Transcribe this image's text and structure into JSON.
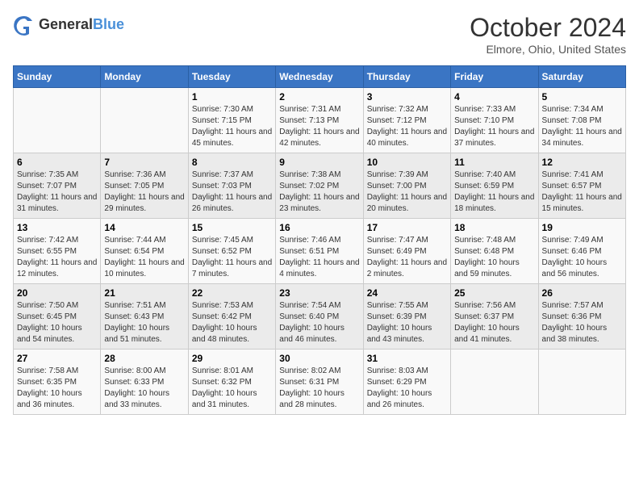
{
  "header": {
    "logo_general": "General",
    "logo_blue": "Blue",
    "month_title": "October 2024",
    "location": "Elmore, Ohio, United States"
  },
  "days_of_week": [
    "Sunday",
    "Monday",
    "Tuesday",
    "Wednesday",
    "Thursday",
    "Friday",
    "Saturday"
  ],
  "weeks": [
    [
      {
        "day": "",
        "sunrise": "",
        "sunset": "",
        "daylight": ""
      },
      {
        "day": "",
        "sunrise": "",
        "sunset": "",
        "daylight": ""
      },
      {
        "day": "1",
        "sunrise": "Sunrise: 7:30 AM",
        "sunset": "Sunset: 7:15 PM",
        "daylight": "Daylight: 11 hours and 45 minutes."
      },
      {
        "day": "2",
        "sunrise": "Sunrise: 7:31 AM",
        "sunset": "Sunset: 7:13 PM",
        "daylight": "Daylight: 11 hours and 42 minutes."
      },
      {
        "day": "3",
        "sunrise": "Sunrise: 7:32 AM",
        "sunset": "Sunset: 7:12 PM",
        "daylight": "Daylight: 11 hours and 40 minutes."
      },
      {
        "day": "4",
        "sunrise": "Sunrise: 7:33 AM",
        "sunset": "Sunset: 7:10 PM",
        "daylight": "Daylight: 11 hours and 37 minutes."
      },
      {
        "day": "5",
        "sunrise": "Sunrise: 7:34 AM",
        "sunset": "Sunset: 7:08 PM",
        "daylight": "Daylight: 11 hours and 34 minutes."
      }
    ],
    [
      {
        "day": "6",
        "sunrise": "Sunrise: 7:35 AM",
        "sunset": "Sunset: 7:07 PM",
        "daylight": "Daylight: 11 hours and 31 minutes."
      },
      {
        "day": "7",
        "sunrise": "Sunrise: 7:36 AM",
        "sunset": "Sunset: 7:05 PM",
        "daylight": "Daylight: 11 hours and 29 minutes."
      },
      {
        "day": "8",
        "sunrise": "Sunrise: 7:37 AM",
        "sunset": "Sunset: 7:03 PM",
        "daylight": "Daylight: 11 hours and 26 minutes."
      },
      {
        "day": "9",
        "sunrise": "Sunrise: 7:38 AM",
        "sunset": "Sunset: 7:02 PM",
        "daylight": "Daylight: 11 hours and 23 minutes."
      },
      {
        "day": "10",
        "sunrise": "Sunrise: 7:39 AM",
        "sunset": "Sunset: 7:00 PM",
        "daylight": "Daylight: 11 hours and 20 minutes."
      },
      {
        "day": "11",
        "sunrise": "Sunrise: 7:40 AM",
        "sunset": "Sunset: 6:59 PM",
        "daylight": "Daylight: 11 hours and 18 minutes."
      },
      {
        "day": "12",
        "sunrise": "Sunrise: 7:41 AM",
        "sunset": "Sunset: 6:57 PM",
        "daylight": "Daylight: 11 hours and 15 minutes."
      }
    ],
    [
      {
        "day": "13",
        "sunrise": "Sunrise: 7:42 AM",
        "sunset": "Sunset: 6:55 PM",
        "daylight": "Daylight: 11 hours and 12 minutes."
      },
      {
        "day": "14",
        "sunrise": "Sunrise: 7:44 AM",
        "sunset": "Sunset: 6:54 PM",
        "daylight": "Daylight: 11 hours and 10 minutes."
      },
      {
        "day": "15",
        "sunrise": "Sunrise: 7:45 AM",
        "sunset": "Sunset: 6:52 PM",
        "daylight": "Daylight: 11 hours and 7 minutes."
      },
      {
        "day": "16",
        "sunrise": "Sunrise: 7:46 AM",
        "sunset": "Sunset: 6:51 PM",
        "daylight": "Daylight: 11 hours and 4 minutes."
      },
      {
        "day": "17",
        "sunrise": "Sunrise: 7:47 AM",
        "sunset": "Sunset: 6:49 PM",
        "daylight": "Daylight: 11 hours and 2 minutes."
      },
      {
        "day": "18",
        "sunrise": "Sunrise: 7:48 AM",
        "sunset": "Sunset: 6:48 PM",
        "daylight": "Daylight: 10 hours and 59 minutes."
      },
      {
        "day": "19",
        "sunrise": "Sunrise: 7:49 AM",
        "sunset": "Sunset: 6:46 PM",
        "daylight": "Daylight: 10 hours and 56 minutes."
      }
    ],
    [
      {
        "day": "20",
        "sunrise": "Sunrise: 7:50 AM",
        "sunset": "Sunset: 6:45 PM",
        "daylight": "Daylight: 10 hours and 54 minutes."
      },
      {
        "day": "21",
        "sunrise": "Sunrise: 7:51 AM",
        "sunset": "Sunset: 6:43 PM",
        "daylight": "Daylight: 10 hours and 51 minutes."
      },
      {
        "day": "22",
        "sunrise": "Sunrise: 7:53 AM",
        "sunset": "Sunset: 6:42 PM",
        "daylight": "Daylight: 10 hours and 48 minutes."
      },
      {
        "day": "23",
        "sunrise": "Sunrise: 7:54 AM",
        "sunset": "Sunset: 6:40 PM",
        "daylight": "Daylight: 10 hours and 46 minutes."
      },
      {
        "day": "24",
        "sunrise": "Sunrise: 7:55 AM",
        "sunset": "Sunset: 6:39 PM",
        "daylight": "Daylight: 10 hours and 43 minutes."
      },
      {
        "day": "25",
        "sunrise": "Sunrise: 7:56 AM",
        "sunset": "Sunset: 6:37 PM",
        "daylight": "Daylight: 10 hours and 41 minutes."
      },
      {
        "day": "26",
        "sunrise": "Sunrise: 7:57 AM",
        "sunset": "Sunset: 6:36 PM",
        "daylight": "Daylight: 10 hours and 38 minutes."
      }
    ],
    [
      {
        "day": "27",
        "sunrise": "Sunrise: 7:58 AM",
        "sunset": "Sunset: 6:35 PM",
        "daylight": "Daylight: 10 hours and 36 minutes."
      },
      {
        "day": "28",
        "sunrise": "Sunrise: 8:00 AM",
        "sunset": "Sunset: 6:33 PM",
        "daylight": "Daylight: 10 hours and 33 minutes."
      },
      {
        "day": "29",
        "sunrise": "Sunrise: 8:01 AM",
        "sunset": "Sunset: 6:32 PM",
        "daylight": "Daylight: 10 hours and 31 minutes."
      },
      {
        "day": "30",
        "sunrise": "Sunrise: 8:02 AM",
        "sunset": "Sunset: 6:31 PM",
        "daylight": "Daylight: 10 hours and 28 minutes."
      },
      {
        "day": "31",
        "sunrise": "Sunrise: 8:03 AM",
        "sunset": "Sunset: 6:29 PM",
        "daylight": "Daylight: 10 hours and 26 minutes."
      },
      {
        "day": "",
        "sunrise": "",
        "sunset": "",
        "daylight": ""
      },
      {
        "day": "",
        "sunrise": "",
        "sunset": "",
        "daylight": ""
      }
    ]
  ]
}
